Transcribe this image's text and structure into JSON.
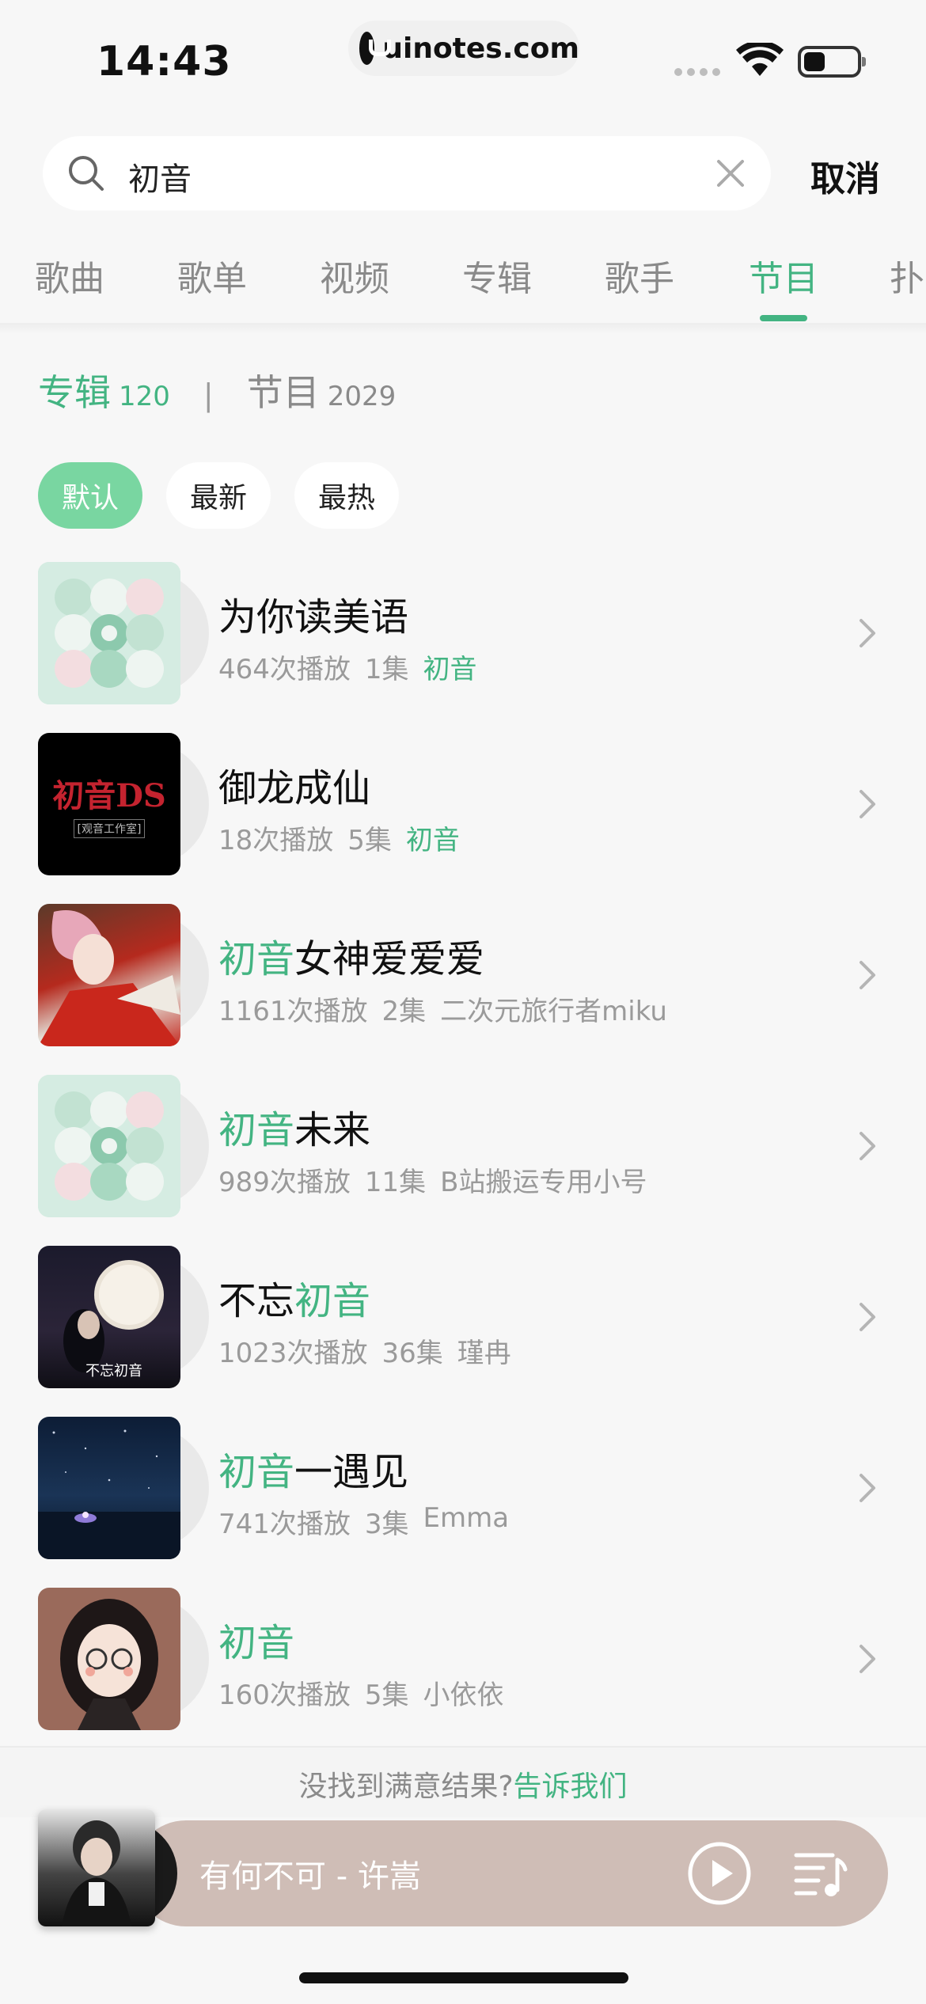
{
  "status_bar": {
    "time": "14:43",
    "url": "uinotes.com"
  },
  "search": {
    "value": "初音",
    "cancel_label": "取消"
  },
  "tabs": [
    {
      "label": "歌曲",
      "active": false
    },
    {
      "label": "歌单",
      "active": false
    },
    {
      "label": "视频",
      "active": false
    },
    {
      "label": "专辑",
      "active": false
    },
    {
      "label": "歌手",
      "active": false
    },
    {
      "label": "节目",
      "active": true
    },
    {
      "label": "扑",
      "active": false
    }
  ],
  "category": {
    "album_label": "专辑",
    "album_count": "120",
    "divider": "|",
    "program_label": "节目",
    "program_count": "2029"
  },
  "sort_chips": [
    {
      "label": "默认",
      "active": true
    },
    {
      "label": "最新",
      "active": false
    },
    {
      "label": "最热",
      "active": false
    }
  ],
  "results": [
    {
      "title_pre": "为你读美语",
      "title_hl": "",
      "title_post": "",
      "plays": "464次播放",
      "episodes": "1集",
      "author": "初音",
      "author_hl": true,
      "art": "default"
    },
    {
      "title_pre": "御龙成仙",
      "title_hl": "",
      "title_post": "",
      "plays": "18次播放",
      "episodes": "5集",
      "author": "初音",
      "author_hl": true,
      "art": "dark",
      "art_text": "初音DS",
      "art_sub": "[观音工作室]"
    },
    {
      "title_pre": "",
      "title_hl": "初音",
      "title_post": "女神爱爱爱",
      "plays": "1161次播放",
      "episodes": "2集",
      "author": "二次元旅行者miku",
      "author_hl": false,
      "art": "anime"
    },
    {
      "title_pre": "",
      "title_hl": "初音",
      "title_post": "未来",
      "plays": "989次播放",
      "episodes": "11集",
      "author": "B站搬运专用小号",
      "author_hl": false,
      "art": "default"
    },
    {
      "title_pre": "不忘",
      "title_hl": "初音",
      "title_post": "",
      "plays": "1023次播放",
      "episodes": "36集",
      "author": "瑾冉",
      "author_hl": false,
      "art": "moon",
      "art_text": "不忘初音"
    },
    {
      "title_pre": "",
      "title_hl": "初音",
      "title_post": "一遇见",
      "plays": "741次播放",
      "episodes": "3集",
      "author": "Emma",
      "author_hl": false,
      "art": "sky"
    },
    {
      "title_pre": "",
      "title_hl": "初音",
      "title_post": "",
      "plays": "160次播放",
      "episodes": "5集",
      "author": "小依依",
      "author_hl": false,
      "art": "girl"
    }
  ],
  "footer": {
    "prompt": "没找到满意结果?",
    "link": "告诉我们"
  },
  "player": {
    "now_playing": "有何不可 - 许嵩"
  },
  "colors": {
    "accent": "#43b482",
    "chip_active": "#79d6a1",
    "player_bg": "#cfbdb6"
  }
}
